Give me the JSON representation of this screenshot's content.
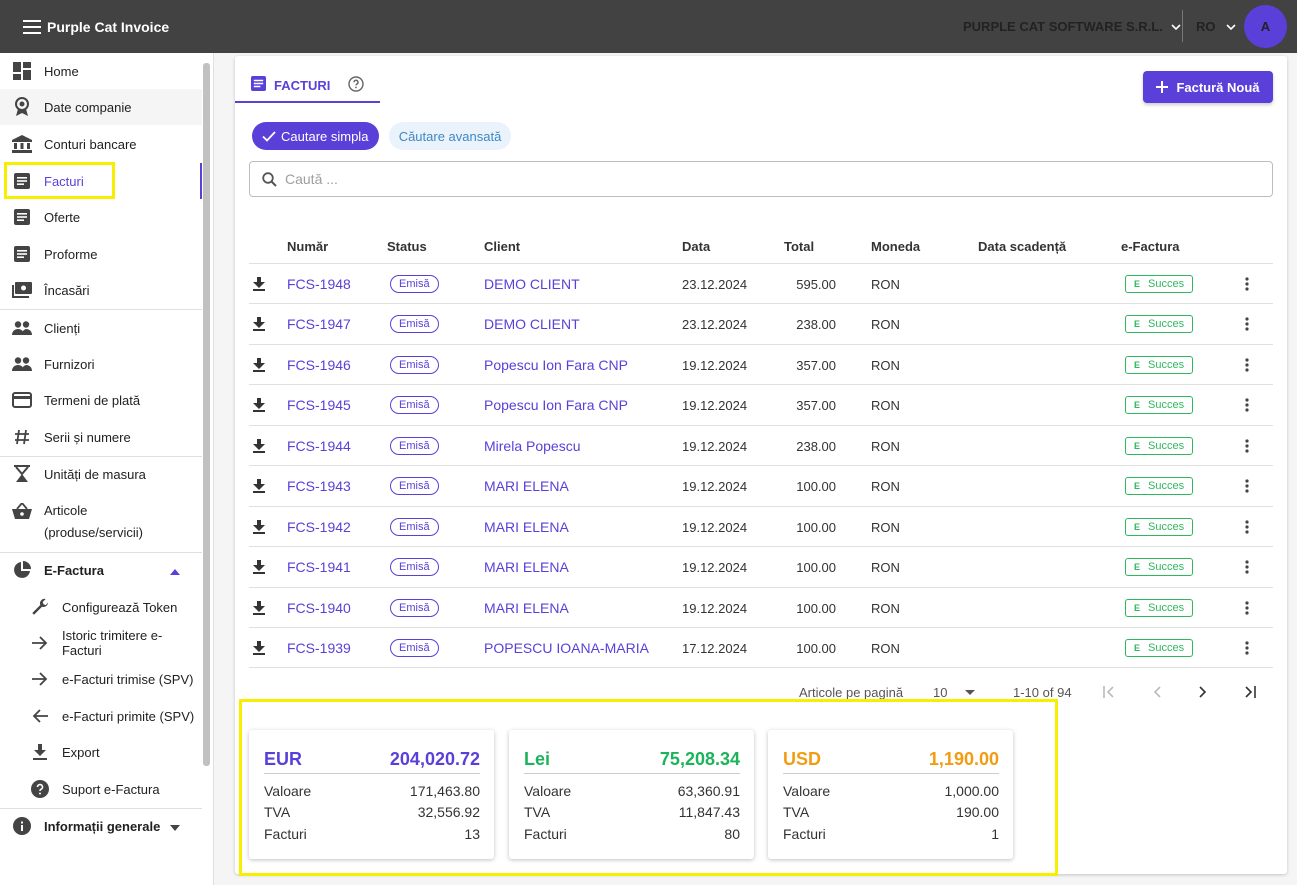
{
  "app": {
    "title": "Purple Cat Invoice",
    "company": "PURPLE CAT SOFTWARE S.R.L.",
    "lang": "RO",
    "avatar": "A"
  },
  "sidebar": {
    "items": [
      {
        "label": "Home",
        "icon": "dashboard-icon"
      },
      {
        "label": "Date companie",
        "icon": "badge-icon"
      },
      {
        "label": "Conturi bancare",
        "icon": "bank-icon"
      },
      {
        "label": "Facturi",
        "icon": "document-icon"
      },
      {
        "label": "Oferte",
        "icon": "document-icon"
      },
      {
        "label": "Proforme",
        "icon": "document-icon"
      },
      {
        "label": "Încasări",
        "icon": "cash-icon"
      },
      {
        "label": "Clienți",
        "icon": "people-icon"
      },
      {
        "label": "Furnizori",
        "icon": "people-icon"
      },
      {
        "label": "Termeni de plată",
        "icon": "credit-card-icon"
      },
      {
        "label": "Serii și numere",
        "icon": "hash-icon"
      },
      {
        "label": "Unități de masura",
        "icon": "scale-icon"
      },
      {
        "label": "Articole",
        "label2": "(produse/servicii)",
        "icon": "basket-icon"
      }
    ],
    "efactura": {
      "label": "E-Factura",
      "items": [
        {
          "label": "Configurează Token",
          "icon": "wrench-icon"
        },
        {
          "label": "Istoric trimitere e-Facturi",
          "icon": "arrow-right-icon"
        },
        {
          "label": "e-Facturi trimise (SPV)",
          "icon": "arrow-right-icon"
        },
        {
          "label": "e-Facturi primite (SPV)",
          "icon": "arrow-left-icon"
        },
        {
          "label": "Export",
          "icon": "download-icon"
        },
        {
          "label": "Suport e-Factura",
          "icon": "help-icon"
        }
      ]
    },
    "info": {
      "label": "Informații generale"
    }
  },
  "tab": {
    "label": "FACTURI"
  },
  "new_button": "Factură Nouă",
  "chips": {
    "simple": "Cautare simpla",
    "advanced": "Căutare avansată"
  },
  "search": {
    "placeholder": "Caută ..."
  },
  "table": {
    "headers": [
      "Număr",
      "Status",
      "Client",
      "Data",
      "Total",
      "Moneda",
      "Data scadență",
      "e-Factura"
    ],
    "rows": [
      {
        "number": "FCS-1948",
        "status": "Emisă",
        "client": "DEMO CLIENT",
        "date": "23.12.2024",
        "total": "595.00",
        "currency": "RON",
        "efactura": "Succes"
      },
      {
        "number": "FCS-1947",
        "status": "Emisă",
        "client": "DEMO CLIENT",
        "date": "23.12.2024",
        "total": "238.00",
        "currency": "RON",
        "efactura": "Succes"
      },
      {
        "number": "FCS-1946",
        "status": "Emisă",
        "client": "Popescu Ion Fara CNP",
        "date": "19.12.2024",
        "total": "357.00",
        "currency": "RON",
        "efactura": "Succes"
      },
      {
        "number": "FCS-1945",
        "status": "Emisă",
        "client": "Popescu Ion Fara CNP",
        "date": "19.12.2024",
        "total": "357.00",
        "currency": "RON",
        "efactura": "Succes"
      },
      {
        "number": "FCS-1944",
        "status": "Emisă",
        "client": "Mirela Popescu",
        "date": "19.12.2024",
        "total": "238.00",
        "currency": "RON",
        "efactura": "Succes"
      },
      {
        "number": "FCS-1943",
        "status": "Emisă",
        "client": "MARI ELENA",
        "date": "19.12.2024",
        "total": "100.00",
        "currency": "RON",
        "efactura": "Succes"
      },
      {
        "number": "FCS-1942",
        "status": "Emisă",
        "client": "MARI ELENA",
        "date": "19.12.2024",
        "total": "100.00",
        "currency": "RON",
        "efactura": "Succes"
      },
      {
        "number": "FCS-1941",
        "status": "Emisă",
        "client": "MARI ELENA",
        "date": "19.12.2024",
        "total": "100.00",
        "currency": "RON",
        "efactura": "Succes"
      },
      {
        "number": "FCS-1940",
        "status": "Emisă",
        "client": "MARI ELENA",
        "date": "19.12.2024",
        "total": "100.00",
        "currency": "RON",
        "efactura": "Succes"
      },
      {
        "number": "FCS-1939",
        "status": "Emisă",
        "client": "POPESCU IOANA-MARIA",
        "date": "17.12.2024",
        "total": "100.00",
        "currency": "RON",
        "efactura": "Succes"
      }
    ]
  },
  "pagination": {
    "per_page_label": "Articole pe pagină",
    "per_page": "10",
    "range": "1-10 of 94"
  },
  "summary": [
    {
      "currency": "EUR",
      "total": "204,020.72",
      "color": "#5b3fd9",
      "valoare": "171,463.80",
      "tva": "32,556.92",
      "facturi": "13"
    },
    {
      "currency": "Lei",
      "total": "75,208.34",
      "color": "#1db35a",
      "valoare": "63,360.91",
      "tva": "11,847.43",
      "facturi": "80"
    },
    {
      "currency": "USD",
      "total": "1,190.00",
      "color": "#f39c12",
      "valoare": "1,000.00",
      "tva": "190.00",
      "facturi": "1"
    }
  ],
  "summary_labels": {
    "valoare": "Valoare",
    "tva": "TVA",
    "facturi": "Facturi"
  }
}
